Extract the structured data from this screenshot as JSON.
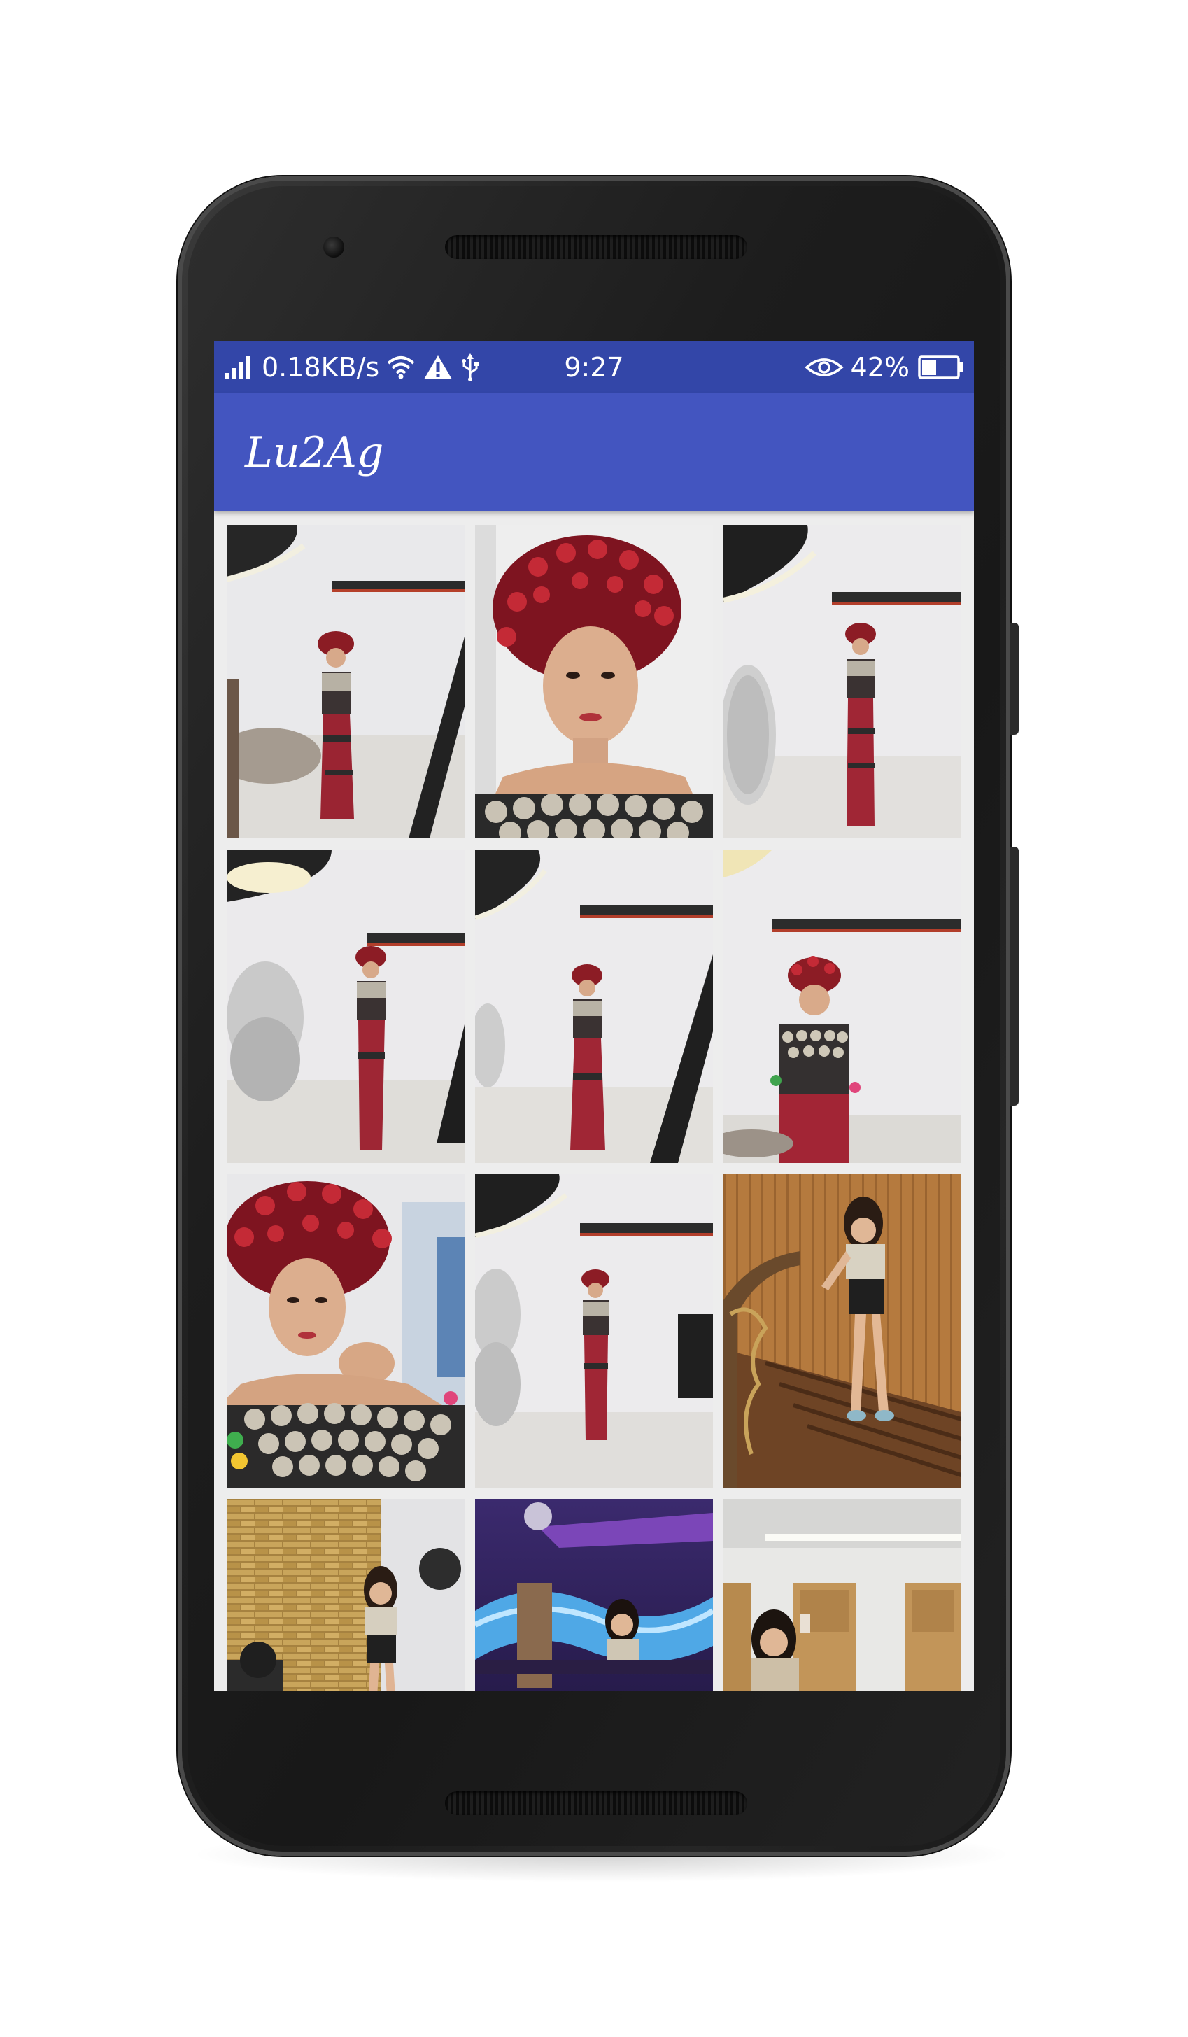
{
  "status_bar": {
    "network_speed": "0.18KB/s",
    "time": "9:27",
    "battery_percent": "42%",
    "icons": [
      "signal-icon",
      "wifi-icon",
      "warning-icon",
      "usb-icon",
      "eye-icon",
      "battery-icon"
    ],
    "battery_level": 0.42
  },
  "app_bar": {
    "title": "Lu2Ag"
  },
  "gallery": {
    "photos": [
      {
        "name": "photo-1",
        "scene": "studio"
      },
      {
        "name": "photo-2",
        "scene": "portrait-closeup"
      },
      {
        "name": "photo-3",
        "scene": "studio"
      },
      {
        "name": "photo-4",
        "scene": "studio"
      },
      {
        "name": "photo-5",
        "scene": "studio"
      },
      {
        "name": "photo-6",
        "scene": "studio"
      },
      {
        "name": "photo-7",
        "scene": "portrait-closeup"
      },
      {
        "name": "photo-8",
        "scene": "studio"
      },
      {
        "name": "photo-9",
        "scene": "staircase"
      },
      {
        "name": "photo-10",
        "scene": "brick-wall"
      },
      {
        "name": "photo-11",
        "scene": "club-lights"
      },
      {
        "name": "photo-12",
        "scene": "hallway"
      }
    ]
  },
  "colors": {
    "status_bar": "#3346a8",
    "app_bar": "#4355c0",
    "background": "#ededed",
    "phone_body": "#1e1e1e"
  }
}
